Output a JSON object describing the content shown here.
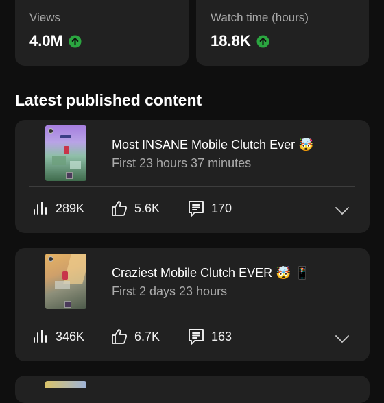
{
  "stats": [
    {
      "label": "Views",
      "value": "4.0M",
      "trend_icon": "arrow-up-circle-icon",
      "trend_color": "#2ba640"
    },
    {
      "label": "Watch time (hours)",
      "value": "18.8K",
      "trend_icon": "arrow-up-circle-icon",
      "trend_color": "#2ba640"
    }
  ],
  "section_title": "Latest published content",
  "videos": [
    {
      "title": "Most INSANE Mobile Clutch Ever 🤯",
      "subtitle": "First 23 hours 37 minutes",
      "views": "289K",
      "likes": "5.6K",
      "comments": "170"
    },
    {
      "title": "Craziest Mobile Clutch EVER 🤯 📱",
      "subtitle": "First 2 days 23 hours",
      "views": "346K",
      "likes": "6.7K",
      "comments": "163"
    }
  ],
  "colors": {
    "background": "#0f0f0f",
    "card": "#212121",
    "trend_up": "#2ba640",
    "muted_text": "#aaaaaa"
  }
}
